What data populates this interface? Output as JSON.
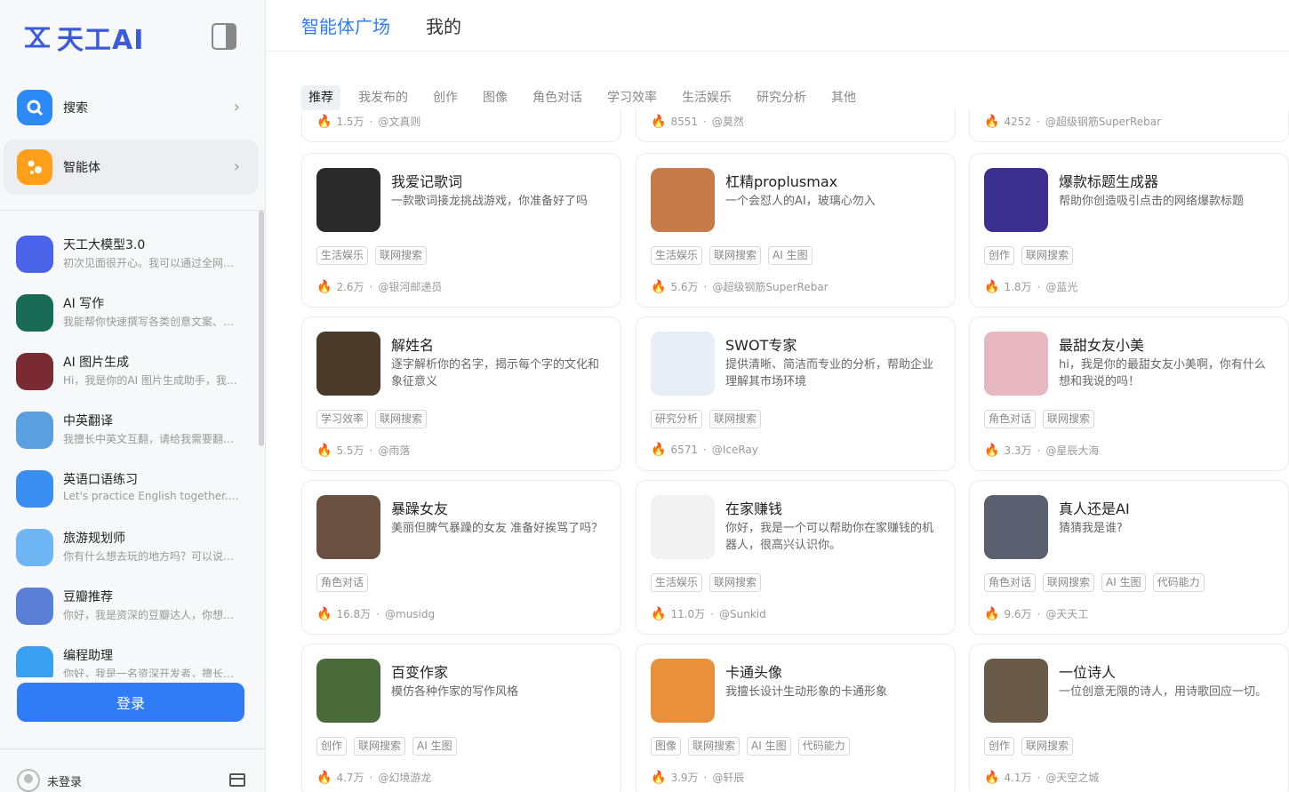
{
  "sidebar": {
    "logo_text": "天工AI",
    "nav": [
      {
        "label": "搜索",
        "icon": "search-icon",
        "color": "#2b8af7"
      },
      {
        "label": "智能体",
        "icon": "agent-icon",
        "color": "#ff9f1a"
      }
    ],
    "agents": [
      {
        "name": "天工大模型3.0",
        "desc": "初次见面很开心。我可以通过全网搜索为你提供帮助",
        "color": "#4a63e8"
      },
      {
        "name": "AI 写作",
        "desc": "我能帮你快速撰写各类创意文案、文章和报告",
        "color": "#1a6b56"
      },
      {
        "name": "AI 图片生成",
        "desc": "Hi，我是你的AI 图片生成助手，我可以为你生成图片",
        "color": "#7a2a32"
      },
      {
        "name": "中英翻译",
        "desc": "我擅长中英文互翻，请给我需要翻译的内容",
        "color": "#5aa0e0"
      },
      {
        "name": "英语口语练习",
        "desc": "Let's practice English together. What would you like",
        "color": "#3a8ef0"
      },
      {
        "name": "旅游规划师",
        "desc": "你有什么想去玩的地方吗？可以说说你的想法",
        "color": "#6fb6f5"
      },
      {
        "name": "豆瓣推荐",
        "desc": "你好，我是资深的豆瓣达人，你想看什么",
        "color": "#5b7fd6"
      },
      {
        "name": "编程助理",
        "desc": "你好，我是一名资深开发者，擅长编程",
        "color": "#3aa0f0"
      }
    ],
    "login_label": "登录",
    "user_label": "未登录"
  },
  "top_tabs": [
    "智能体广场",
    "我的"
  ],
  "categories": [
    "推荐",
    "我发布的",
    "创作",
    "图像",
    "角色对话",
    "学习效率",
    "生活娱乐",
    "研究分析",
    "其他"
  ],
  "partial_stats": [
    {
      "heat": "1.5万",
      "author": "@文真则"
    },
    {
      "heat": "8551",
      "author": "@莫然"
    },
    {
      "heat": "4252",
      "author": "@超级钢筋SuperRebar"
    }
  ],
  "cards": [
    {
      "title": "我爱记歌词",
      "desc": "一款歌词接龙挑战游戏，你准备好了吗",
      "tags": [
        "生活娱乐",
        "联网搜索"
      ],
      "heat": "2.6万",
      "author": "@银河邮递员",
      "img_color": "#2a2a2a"
    },
    {
      "title": "杠精proplusmax",
      "desc": "一个会怼人的AI，玻璃心勿入",
      "tags": [
        "生活娱乐",
        "联网搜索",
        "AI 生图"
      ],
      "heat": "5.6万",
      "author": "@超级钢筋SuperRebar",
      "img_color": "#c77a4a"
    },
    {
      "title": "爆款标题生成器",
      "desc": "帮助你创造吸引点击的网络爆款标题",
      "tags": [
        "创作",
        "联网搜索"
      ],
      "heat": "1.8万",
      "author": "@蓝光",
      "img_color": "#3b2f8f"
    },
    {
      "title": "解姓名",
      "desc": "逐字解析你的名字，揭示每个字的文化和象征意义",
      "tags": [
        "学习效率",
        "联网搜索"
      ],
      "heat": "5.5万",
      "author": "@雨落",
      "img_color": "#4a3a2a"
    },
    {
      "title": "SWOT专家",
      "desc": "提供清晰、简洁而专业的分析，帮助企业理解其市场环境",
      "tags": [
        "研究分析",
        "联网搜索"
      ],
      "heat": "6571",
      "author": "@IceRay",
      "img_color": "#e8eef5"
    },
    {
      "title": "最甜女友小美",
      "desc": "hi，我是你的最甜女友小美啊，你有什么想和我说的吗！",
      "tags": [
        "角色对话",
        "联网搜索"
      ],
      "heat": "3.3万",
      "author": "@星辰大海",
      "img_color": "#e8b8c0"
    },
    {
      "title": "暴躁女友",
      "desc": "美丽但脾气暴躁的女友 准备好挨骂了吗？",
      "tags": [
        "角色对话"
      ],
      "heat": "16.8万",
      "author": "@musidg",
      "img_color": "#6a5040"
    },
    {
      "title": "在家赚钱",
      "desc": "你好，我是一个可以帮助你在家赚钱的机器人，很高兴认识你。",
      "tags": [
        "生活娱乐",
        "联网搜索"
      ],
      "heat": "11.0万",
      "author": "@Sunkid",
      "img_color": "#f2f2f2"
    },
    {
      "title": "真人还是AI",
      "desc": "猜猜我是谁?",
      "tags": [
        "角色对话",
        "联网搜索",
        "AI 生图",
        "代码能力"
      ],
      "heat": "9.6万",
      "author": "@天天工",
      "img_color": "#5a6070"
    },
    {
      "title": "百变作家",
      "desc": "模仿各种作家的写作风格",
      "tags": [
        "创作",
        "联网搜索",
        "AI 生图"
      ],
      "heat": "4.7万",
      "author": "@幻境游龙",
      "img_color": "#4a6a3a"
    },
    {
      "title": "卡通头像",
      "desc": "我擅长设计生动形象的卡通形象",
      "tags": [
        "图像",
        "联网搜索",
        "AI 生图",
        "代码能力"
      ],
      "heat": "3.9万",
      "author": "@轩辰",
      "img_color": "#e8903a"
    },
    {
      "title": "一位诗人",
      "desc": "一位创意无限的诗人，用诗歌回应一切。",
      "tags": [
        "创作",
        "联网搜索"
      ],
      "heat": "4.1万",
      "author": "@天空之城",
      "img_color": "#6a5a4a"
    }
  ]
}
